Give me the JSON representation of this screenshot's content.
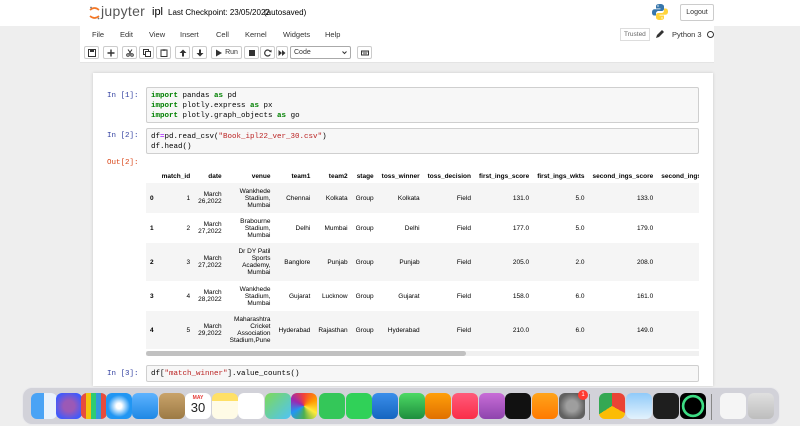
{
  "header": {
    "logo_text": "jupyter",
    "notebook_name": "ipl",
    "checkpoint": "Last Checkpoint: 23/05/2022",
    "autosave_status": "(autosaved)",
    "logout_label": "Logout"
  },
  "menubar": {
    "items": [
      "File",
      "Edit",
      "View",
      "Insert",
      "Cell",
      "Kernel",
      "Widgets",
      "Help"
    ],
    "trusted_label": "Trusted",
    "kernel_name": "Python 3"
  },
  "toolbar": {
    "run_label": "Run",
    "cell_type": "Code"
  },
  "cells": [
    {
      "prompt": "In [1]:",
      "lines": [
        [
          "import",
          " pandas ",
          "as",
          " pd"
        ],
        [
          "import",
          " plotly.express ",
          "as",
          " px"
        ],
        [
          "import",
          " plotly.graph_objects ",
          "as",
          " go"
        ]
      ]
    },
    {
      "prompt": "In [2]:",
      "line1_pre": "df",
      "line1_eq": "=",
      "line1_mid": "pd.read_csv(",
      "line1_str": "\"Book_ipl22_ver_30.csv\"",
      "line1_post": ")",
      "line2": "df.head()"
    },
    {
      "prompt": "In [3]:",
      "pre": "df[",
      "str": "\"match_winner\"",
      "post": "].value_counts()"
    }
  ],
  "output": {
    "prompt": "Out[2]:",
    "columns": [
      "",
      "match_id",
      "date",
      "venue",
      "team1",
      "team2",
      "stage",
      "toss_winner",
      "toss_decision",
      "first_ings_score",
      "first_ings_wkts",
      "second_ings_score",
      "second_ings_v"
    ],
    "rows": [
      [
        "0",
        "1",
        "March 26,2022",
        "Wankhede Stadium, Mumbai",
        "Chennai",
        "Kolkata",
        "Group",
        "Kolkata",
        "Field",
        "131.0",
        "5.0",
        "133.0",
        ""
      ],
      [
        "1",
        "2",
        "March 27,2022",
        "Brabourne Stadium, Mumbai",
        "Delhi",
        "Mumbai",
        "Group",
        "Delhi",
        "Field",
        "177.0",
        "5.0",
        "179.0",
        ""
      ],
      [
        "2",
        "3",
        "March 27,2022",
        "Dr DY Patil Sports Academy, Mumbai",
        "Banglore",
        "Punjab",
        "Group",
        "Punjab",
        "Field",
        "205.0",
        "2.0",
        "208.0",
        ""
      ],
      [
        "3",
        "4",
        "March 28,2022",
        "Wankhede Stadium, Mumbai",
        "Gujarat",
        "Lucknow",
        "Group",
        "Gujarat",
        "Field",
        "158.0",
        "6.0",
        "161.0",
        ""
      ],
      [
        "4",
        "5",
        "March 29,2022",
        "Maharashtra Cricket Association Stadium,Pune",
        "Hyderabad",
        "Rajasthan",
        "Group",
        "Hyderabad",
        "Field",
        "210.0",
        "6.0",
        "149.0",
        ""
      ]
    ]
  },
  "dock": {
    "calendar_month": "MAY",
    "calendar_day": "30",
    "notification_badge": "1",
    "icons": [
      "finder-icon",
      "launchpad-icon",
      "apps-grid-icon",
      "safari-icon",
      "mail-icon",
      "contacts-icon",
      "calendar-icon",
      "notes-icon",
      "reminders-icon",
      "maps-icon",
      "photos-icon",
      "messages-icon",
      "facetime-icon",
      "keynote-icon",
      "numbers-icon",
      "pages-icon",
      "music-icon",
      "podcasts-icon",
      "tv-icon",
      "books-icon",
      "system-preferences-icon",
      "chrome-icon",
      "preview-icon",
      "terminal-icon",
      "activity-ring-icon",
      "document-icon",
      "trash-icon"
    ]
  }
}
